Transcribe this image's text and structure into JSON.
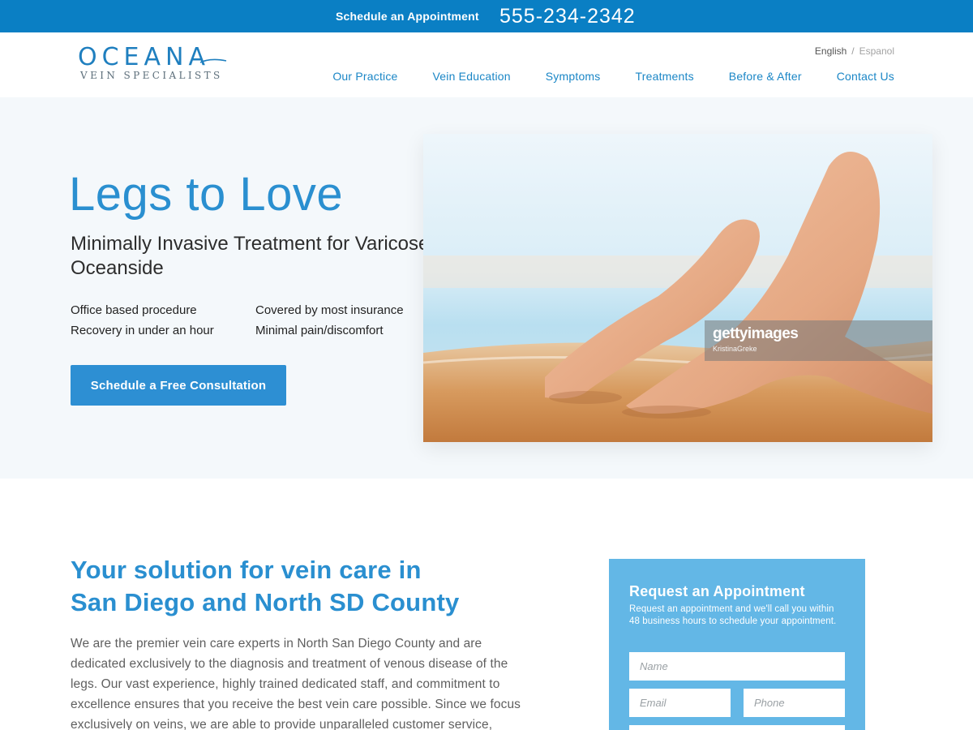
{
  "topbar": {
    "schedule_label": "Schedule an Appointment",
    "phone": "555-234-2342"
  },
  "header": {
    "logo_name": "OCEANA",
    "logo_sub": "VEIN SPECIALISTS",
    "languages": {
      "active": "English",
      "separator": "/",
      "inactive": "Espanol"
    },
    "nav": [
      "Our Practice",
      "Vein Education",
      "Symptoms",
      "Treatments",
      "Before & After",
      "Contact Us"
    ]
  },
  "hero": {
    "title": "Legs to Love",
    "subtitle": "Minimally Invasive Treatment for Varicose Veins in Oceanside",
    "features": [
      "Office based procedure",
      "Covered by most insurance",
      "Recovery in under an hour",
      "Minimal pain/discomfort"
    ],
    "cta_label": "Schedule a Free Consultation",
    "image": {
      "watermark_brand": "gettyimages",
      "watermark_credit": "KristinaGreke"
    }
  },
  "solution": {
    "title_line1": "Your solution for vein care in",
    "title_line2": "San Diego and North SD County",
    "body": "We are the premier vein care experts in North San Diego County and are dedicated exclusively to the diagnosis and treatment of venous disease of the legs. Our vast experience, highly trained dedicated staff, and commitment to excellence ensures that you receive the best vein care possible. Since we focus exclusively on veins, we are able to provide unparalleled customer service,"
  },
  "form": {
    "title": "Request an Appointment",
    "description": "Request an appointment and we'll call you within 48 business hours to schedule your appointment.",
    "name_placeholder": "Name",
    "email_placeholder": "Email",
    "phone_placeholder": "Phone"
  },
  "colors": {
    "brand_blue": "#0a7fc4",
    "accent_blue": "#2a8fd0",
    "form_blue": "#63b7e6",
    "hero_bg": "#f4f8fb"
  }
}
